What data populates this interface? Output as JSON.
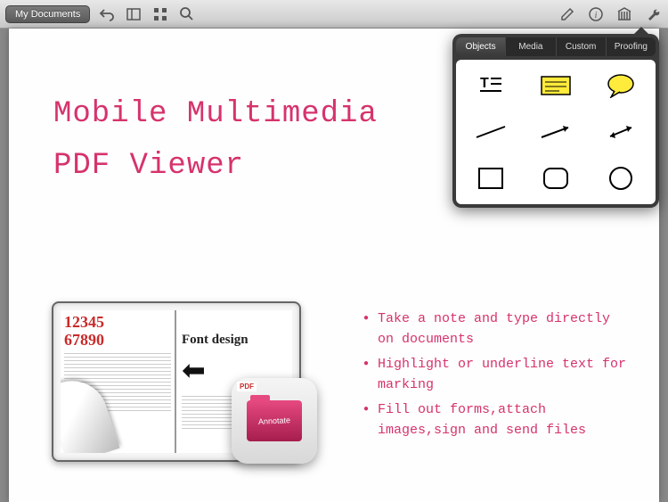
{
  "toolbar": {
    "my_documents_label": "My Documents"
  },
  "page": {
    "title_line1": "Mobile Multimedia",
    "title_line2": "PDF Viewer"
  },
  "popover": {
    "tabs": [
      "Objects",
      "Media",
      "Custom",
      "Proofing"
    ],
    "active_tab_index": 0,
    "tools": [
      "text-tool",
      "note-tool",
      "comment-bubble-tool",
      "line-tool",
      "arrow-single-tool",
      "arrow-double-tool",
      "rectangle-tool",
      "rounded-rectangle-tool",
      "circle-tool"
    ]
  },
  "tablet": {
    "decorative_numbers_line1": "12345",
    "decorative_numbers_line2": "67890",
    "font_design_label": "Font design"
  },
  "app_icon": {
    "pdf_label": "PDF",
    "folder_label": "Annotate"
  },
  "bullets": [
    "Take a note and type directly on documents",
    "Highlight or underline text for marking",
    "Fill out forms,attach images,sign and send files"
  ],
  "colors": {
    "accent": "#d6336c"
  }
}
